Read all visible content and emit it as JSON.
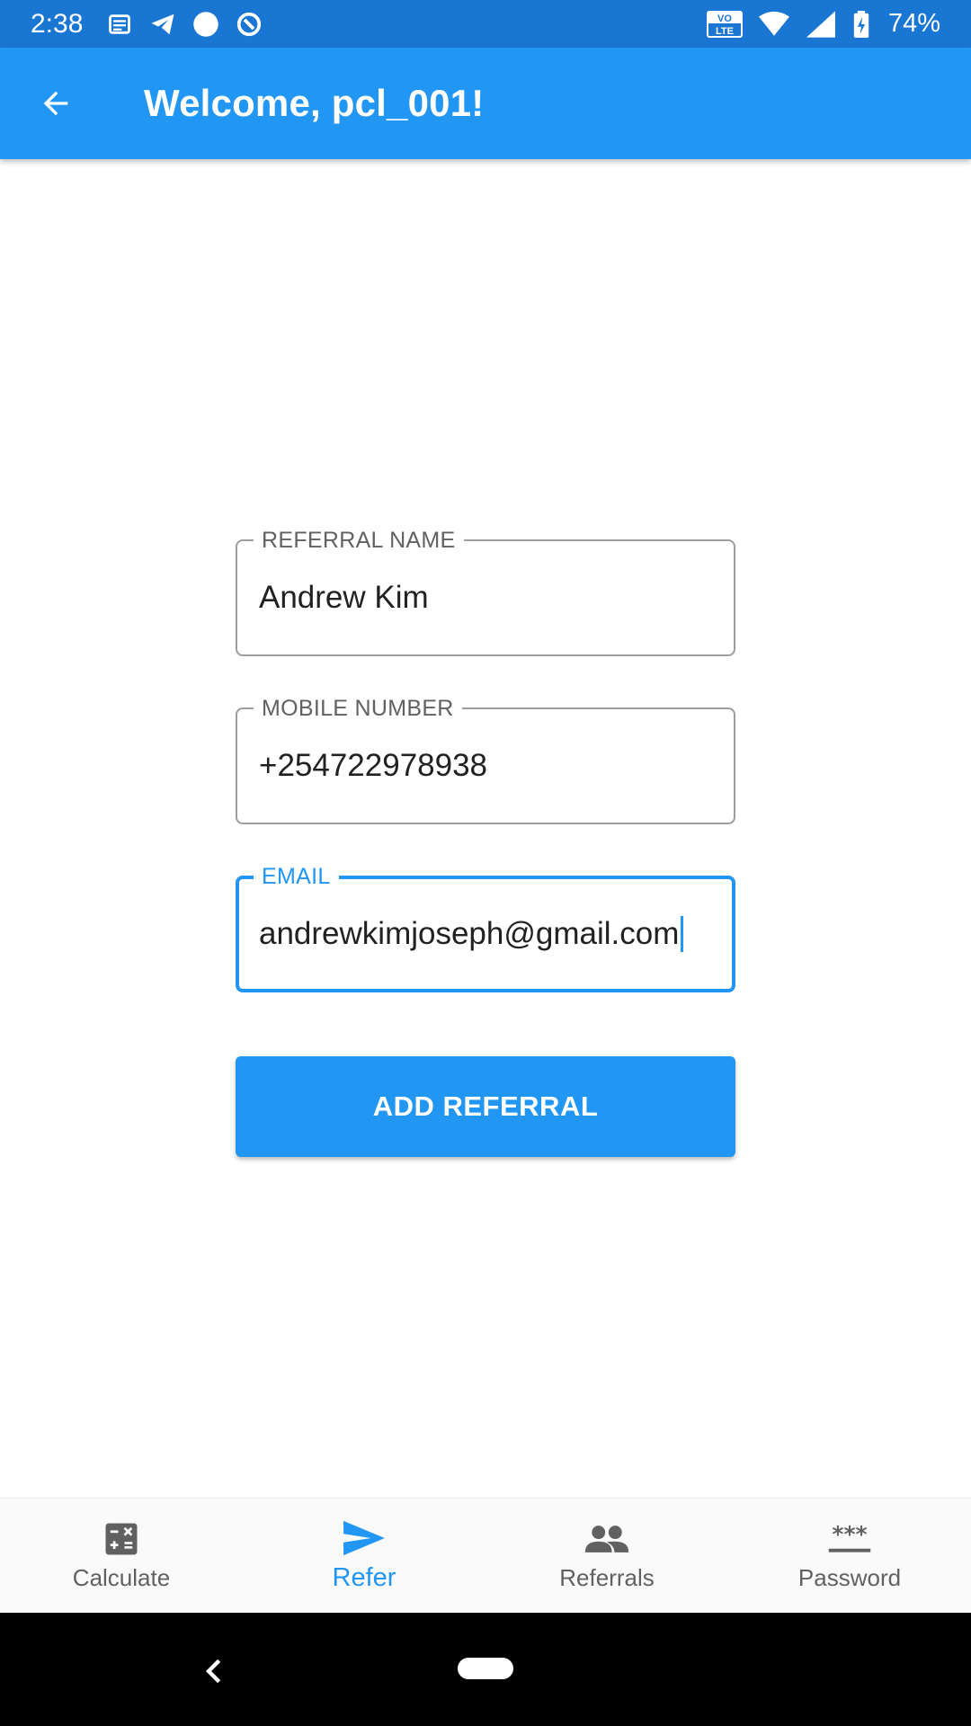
{
  "status_bar": {
    "time": "2:38",
    "battery_percent": "74%",
    "network_label": "VO LTE"
  },
  "app_bar": {
    "title": "Welcome, pcl_001!"
  },
  "form": {
    "referral_name": {
      "label": "REFERRAL NAME",
      "value": "Andrew Kim"
    },
    "mobile_number": {
      "label": "MOBILE NUMBER",
      "value": "+254722978938"
    },
    "email": {
      "label": "EMAIL",
      "value": "andrewkimjoseph@gmail.com"
    },
    "submit_label": "ADD REFERRAL"
  },
  "bottom_nav": {
    "items": [
      {
        "label": "Calculate",
        "icon": "calculator-icon"
      },
      {
        "label": "Refer",
        "icon": "send-icon",
        "active": true
      },
      {
        "label": "Referrals",
        "icon": "people-icon"
      },
      {
        "label": "Password",
        "icon": "password-icon"
      }
    ]
  },
  "colors": {
    "primary": "#2196F3",
    "status_bar": "#1976D2",
    "nav_inactive": "#616161"
  }
}
